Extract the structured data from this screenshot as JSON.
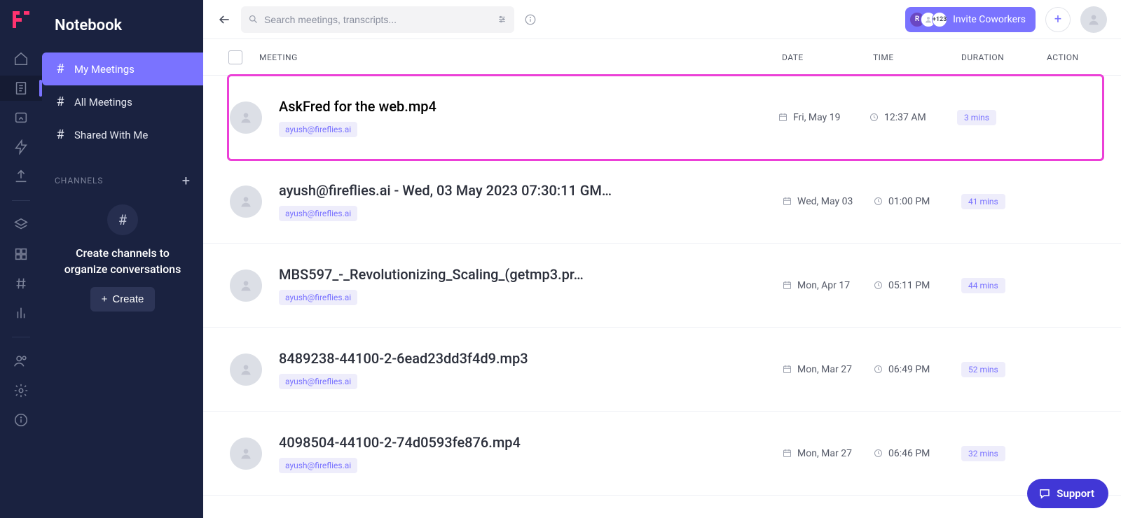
{
  "app": {
    "name": "Notebook"
  },
  "sidebar": {
    "items": [
      {
        "label": "My Meetings"
      },
      {
        "label": "All Meetings"
      },
      {
        "label": "Shared With Me"
      }
    ],
    "channels_label": "CHANNELS",
    "channels_empty": "Create channels to organize conversations",
    "create_label": "Create"
  },
  "search": {
    "placeholder": "Search meetings, transcripts..."
  },
  "invite": {
    "label": "Invite Coworkers",
    "extra_count": "+123",
    "initial": "R"
  },
  "columns": {
    "meeting": "MEETING",
    "date": "DATE",
    "time": "TIME",
    "duration": "DURATION",
    "action": "ACTION"
  },
  "meetings": [
    {
      "title": "AskFred for the web.mp4",
      "owner": "ayush@fireflies.ai",
      "date": "Fri, May 19",
      "time": "12:37 AM",
      "duration": "3 mins"
    },
    {
      "title": "ayush@fireflies.ai - Wed, 03 May 2023 07:30:11 GM…",
      "owner": "ayush@fireflies.ai",
      "date": "Wed, May 03",
      "time": "01:00 PM",
      "duration": "41 mins"
    },
    {
      "title": "MBS597_-_Revolutionizing_Scaling_(getmp3.pr…",
      "owner": "ayush@fireflies.ai",
      "date": "Mon, Apr 17",
      "time": "05:11 PM",
      "duration": "44 mins"
    },
    {
      "title": "8489238-44100-2-6ead23dd3f4d9.mp3",
      "owner": "ayush@fireflies.ai",
      "date": "Mon, Mar 27",
      "time": "06:49 PM",
      "duration": "52 mins"
    },
    {
      "title": "4098504-44100-2-74d0593fe876.mp4",
      "owner": "ayush@fireflies.ai",
      "date": "Mon, Mar 27",
      "time": "06:46 PM",
      "duration": "32 mins"
    }
  ],
  "support": {
    "label": "Support"
  }
}
